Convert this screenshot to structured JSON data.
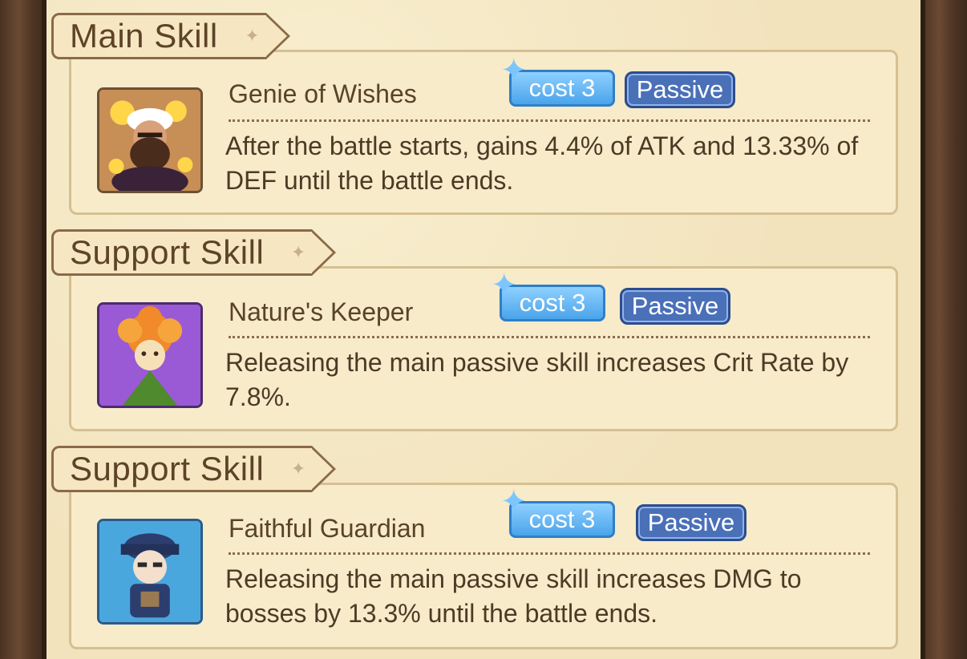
{
  "sections": [
    {
      "header": "Main Skill",
      "skill": {
        "name": "Genie of Wishes",
        "cost": "cost 3",
        "type": "Passive",
        "description": "After the battle starts, gains 4.4% of ATK and 13.33% of DEF until the battle ends.",
        "icon": "genie-portrait-icon"
      }
    },
    {
      "header": "Support Skill",
      "skill": {
        "name": "Nature's Keeper",
        "cost": "cost 3",
        "type": "Passive",
        "description": "Releasing the main passive skill increases Crit Rate by 7.8%.",
        "icon": "flower-keeper-portrait-icon"
      }
    },
    {
      "header": "Support Skill",
      "skill": {
        "name": "Faithful Guardian",
        "cost": "cost 3",
        "type": "Passive",
        "description": "Releasing the main passive skill increases DMG to bosses by 13.3% until the battle ends.",
        "icon": "guardian-portrait-icon"
      }
    }
  ],
  "colors": {
    "panel_bg": "#f2e3bd",
    "cost_badge": "#4aa4ea",
    "passive_badge": "#4a70b8",
    "text": "#4d3a25"
  }
}
